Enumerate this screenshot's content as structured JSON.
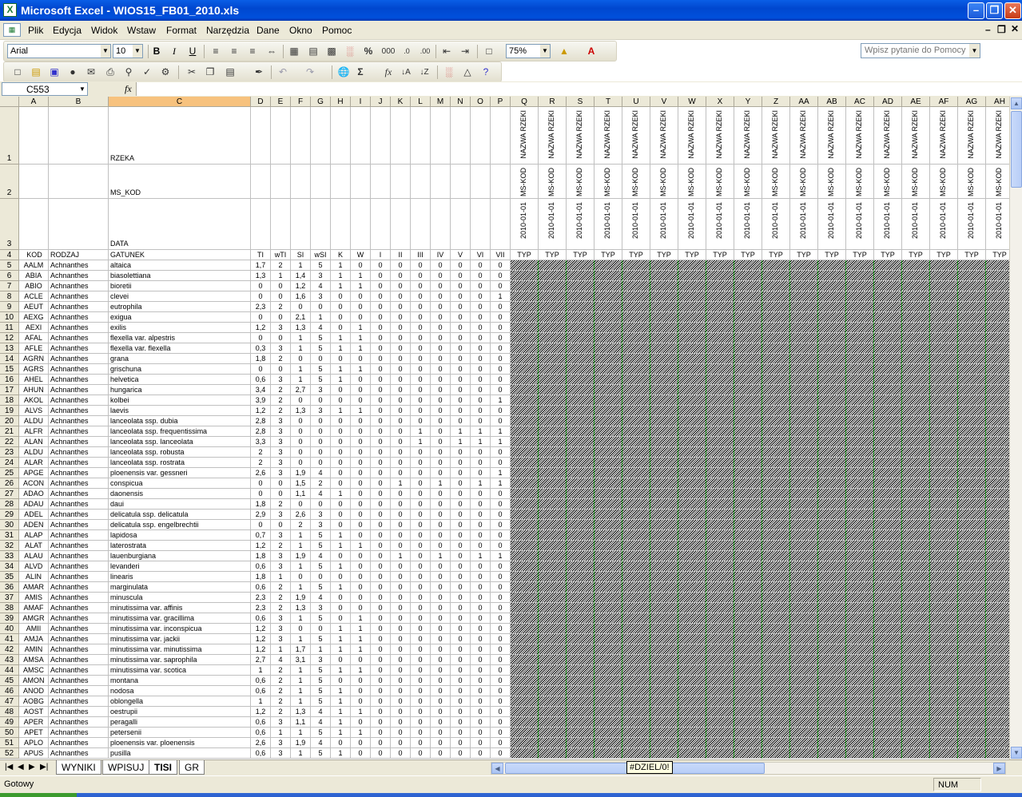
{
  "window": {
    "title": "Microsoft Excel - WIOS15_FB01_2010.xls",
    "app_icon": "excel-icon"
  },
  "menu": [
    "Plik",
    "Edycja",
    "Widok",
    "Wstaw",
    "Format",
    "Narzędzia",
    "Dane",
    "Okno",
    "Pomoc"
  ],
  "help_placeholder": "Wpisz pytanie do Pomocy",
  "formatting": {
    "font": "Arial",
    "size": "10",
    "zoom": "75%",
    "bold": "B",
    "italic": "I",
    "underline": "U",
    "percent": "%",
    "thousands": "000"
  },
  "namebox": "C553",
  "fx_label": "fx",
  "columns": [
    "A",
    "B",
    "C",
    "D",
    "E",
    "F",
    "G",
    "H",
    "I",
    "J",
    "K",
    "L",
    "M",
    "N",
    "O",
    "P",
    "Q",
    "R",
    "S",
    "T",
    "U",
    "V",
    "W",
    "X",
    "Y",
    "Z",
    "AA",
    "AB",
    "AC",
    "AD",
    "AE",
    "AF",
    "AG",
    "AH"
  ],
  "header_rows": {
    "row1_label": "RZEKA",
    "row2_label": "MS_KOD",
    "row3_label": "DATA",
    "q_row1": "NAZWA RZEKI",
    "q_row2": "MS-KOD",
    "q_row3": "2010-01-01",
    "typ": "TYP",
    "row4": [
      "KOD",
      "RODZAJ",
      "GATUNEK",
      "TI",
      "wTI",
      "SI",
      "wSI",
      "K",
      "W",
      "I",
      "II",
      "III",
      "IV",
      "V",
      "VI",
      "VII"
    ]
  },
  "error_placeholder": "#####",
  "rows": [
    [
      "AALM",
      "Achnanthes",
      "altaica",
      "1,7",
      "2",
      "1",
      "5",
      "1",
      "0",
      "0",
      "0",
      "0",
      "0",
      "0",
      "0",
      "0"
    ],
    [
      "ABIA",
      "Achnanthes",
      "biasolettiana",
      "1,3",
      "1",
      "1,4",
      "3",
      "1",
      "1",
      "0",
      "0",
      "0",
      "0",
      "0",
      "0",
      "0"
    ],
    [
      "ABIO",
      "Achnanthes",
      "bioretii",
      "0",
      "0",
      "1,2",
      "4",
      "1",
      "1",
      "0",
      "0",
      "0",
      "0",
      "0",
      "0",
      "0"
    ],
    [
      "ACLE",
      "Achnanthes",
      "clevei",
      "0",
      "0",
      "1,6",
      "3",
      "0",
      "0",
      "0",
      "0",
      "0",
      "0",
      "0",
      "0",
      "1"
    ],
    [
      "AEUT",
      "Achnanthes",
      "eutrophila",
      "2,3",
      "2",
      "0",
      "0",
      "0",
      "0",
      "0",
      "0",
      "0",
      "0",
      "0",
      "0",
      "0"
    ],
    [
      "AEXG",
      "Achnanthes",
      "exigua",
      "0",
      "0",
      "2,1",
      "1",
      "0",
      "0",
      "0",
      "0",
      "0",
      "0",
      "0",
      "0",
      "0"
    ],
    [
      "AEXI",
      "Achnanthes",
      "exilis",
      "1,2",
      "3",
      "1,3",
      "4",
      "0",
      "1",
      "0",
      "0",
      "0",
      "0",
      "0",
      "0",
      "0"
    ],
    [
      "AFAL",
      "Achnanthes",
      "flexella  var. alpestris",
      "0",
      "0",
      "1",
      "5",
      "1",
      "1",
      "0",
      "0",
      "0",
      "0",
      "0",
      "0",
      "0"
    ],
    [
      "AFLE",
      "Achnanthes",
      "flexella var. flexella",
      "0,3",
      "3",
      "1",
      "5",
      "1",
      "1",
      "0",
      "0",
      "0",
      "0",
      "0",
      "0",
      "0"
    ],
    [
      "AGRN",
      "Achnanthes",
      "grana",
      "1,8",
      "2",
      "0",
      "0",
      "0",
      "0",
      "0",
      "0",
      "0",
      "0",
      "0",
      "0",
      "0"
    ],
    [
      "AGRS",
      "Achnanthes",
      "grischuna",
      "0",
      "0",
      "1",
      "5",
      "1",
      "1",
      "0",
      "0",
      "0",
      "0",
      "0",
      "0",
      "0"
    ],
    [
      "AHEL",
      "Achnanthes",
      "helvetica",
      "0,6",
      "3",
      "1",
      "5",
      "1",
      "0",
      "0",
      "0",
      "0",
      "0",
      "0",
      "0",
      "0"
    ],
    [
      "AHUN",
      "Achnanthes",
      "hungarica",
      "3,4",
      "2",
      "2,7",
      "3",
      "0",
      "0",
      "0",
      "0",
      "0",
      "0",
      "0",
      "0",
      "0"
    ],
    [
      "AKOL",
      "Achnanthes",
      "kolbei",
      "3,9",
      "2",
      "0",
      "0",
      "0",
      "0",
      "0",
      "0",
      "0",
      "0",
      "0",
      "0",
      "1"
    ],
    [
      "ALVS",
      "Achnanthes",
      "laevis",
      "1,2",
      "2",
      "1,3",
      "3",
      "1",
      "1",
      "0",
      "0",
      "0",
      "0",
      "0",
      "0",
      "0"
    ],
    [
      "ALDU",
      "Achnanthes",
      "lanceolata ssp. dubia",
      "2,8",
      "3",
      "0",
      "0",
      "0",
      "0",
      "0",
      "0",
      "0",
      "0",
      "0",
      "0",
      "0"
    ],
    [
      "ALFR",
      "Achnanthes",
      "lanceolata ssp. frequentissima",
      "2,8",
      "3",
      "0",
      "0",
      "0",
      "0",
      "0",
      "0",
      "1",
      "0",
      "1",
      "1",
      "1"
    ],
    [
      "ALAN",
      "Achnanthes",
      "lanceolata ssp. lanceolata",
      "3,3",
      "3",
      "0",
      "0",
      "0",
      "0",
      "0",
      "0",
      "1",
      "0",
      "1",
      "1",
      "1"
    ],
    [
      "ALDU",
      "Achnanthes",
      "lanceolata ssp. robusta",
      "2",
      "3",
      "0",
      "0",
      "0",
      "0",
      "0",
      "0",
      "0",
      "0",
      "0",
      "0",
      "0"
    ],
    [
      "ALAR",
      "Achnanthes",
      "lanceolata ssp. rostrata",
      "2",
      "3",
      "0",
      "0",
      "0",
      "0",
      "0",
      "0",
      "0",
      "0",
      "0",
      "0",
      "0"
    ],
    [
      "APGE",
      "Achnanthes",
      "ploenensis var. gessneri",
      "2,6",
      "3",
      "1,9",
      "4",
      "0",
      "0",
      "0",
      "0",
      "0",
      "0",
      "0",
      "0",
      "1"
    ],
    [
      "ACON",
      "Achnanthes",
      "conspicua",
      "0",
      "0",
      "1,5",
      "2",
      "0",
      "0",
      "0",
      "1",
      "0",
      "1",
      "0",
      "1",
      "1"
    ],
    [
      "ADAO",
      "Achnanthes",
      "daonensis",
      "0",
      "0",
      "1,1",
      "4",
      "1",
      "0",
      "0",
      "0",
      "0",
      "0",
      "0",
      "0",
      "0"
    ],
    [
      "ADAU",
      "Achnanthes",
      "daui",
      "1,8",
      "2",
      "0",
      "0",
      "0",
      "0",
      "0",
      "0",
      "0",
      "0",
      "0",
      "0",
      "0"
    ],
    [
      "ADEL",
      "Achnanthes",
      "delicatula ssp. delicatula",
      "2,9",
      "3",
      "2,6",
      "3",
      "0",
      "0",
      "0",
      "0",
      "0",
      "0",
      "0",
      "0",
      "0"
    ],
    [
      "ADEN",
      "Achnanthes",
      "delicatula ssp. engelbrechtii",
      "0",
      "0",
      "2",
      "3",
      "0",
      "0",
      "0",
      "0",
      "0",
      "0",
      "0",
      "0",
      "0"
    ],
    [
      "ALAP",
      "Achnanthes",
      "lapidosa",
      "0,7",
      "3",
      "1",
      "5",
      "1",
      "0",
      "0",
      "0",
      "0",
      "0",
      "0",
      "0",
      "0"
    ],
    [
      "ALAT",
      "Achnanthes",
      "laterostrata",
      "1,2",
      "2",
      "1",
      "5",
      "1",
      "1",
      "0",
      "0",
      "0",
      "0",
      "0",
      "0",
      "0"
    ],
    [
      "ALAU",
      "Achnanthes",
      "lauenburgiana",
      "1,8",
      "3",
      "1,9",
      "4",
      "0",
      "0",
      "0",
      "1",
      "0",
      "1",
      "0",
      "1",
      "1"
    ],
    [
      "ALVD",
      "Achnanthes",
      "levanderi",
      "0,6",
      "3",
      "1",
      "5",
      "1",
      "0",
      "0",
      "0",
      "0",
      "0",
      "0",
      "0",
      "0"
    ],
    [
      "ALIN",
      "Achnanthes",
      "linearis",
      "1,8",
      "1",
      "0",
      "0",
      "0",
      "0",
      "0",
      "0",
      "0",
      "0",
      "0",
      "0",
      "0"
    ],
    [
      "AMAR",
      "Achnanthes",
      "marginulata",
      "0,6",
      "2",
      "1",
      "5",
      "1",
      "0",
      "0",
      "0",
      "0",
      "0",
      "0",
      "0",
      "0"
    ],
    [
      "AMIS",
      "Achnanthes",
      "minuscula",
      "2,3",
      "2",
      "1,9",
      "4",
      "0",
      "0",
      "0",
      "0",
      "0",
      "0",
      "0",
      "0",
      "0"
    ],
    [
      "AMAF",
      "Achnanthes",
      "minutissima var. affinis",
      "2,3",
      "2",
      "1,3",
      "3",
      "0",
      "0",
      "0",
      "0",
      "0",
      "0",
      "0",
      "0",
      "0"
    ],
    [
      "AMGR",
      "Achnanthes",
      "minutissima var. gracillima",
      "0,6",
      "3",
      "1",
      "5",
      "0",
      "1",
      "0",
      "0",
      "0",
      "0",
      "0",
      "0",
      "0"
    ],
    [
      "AMII",
      "Achnanthes",
      "minutissima var. inconspicua",
      "1,2",
      "3",
      "0",
      "0",
      "1",
      "1",
      "0",
      "0",
      "0",
      "0",
      "0",
      "0",
      "0"
    ],
    [
      "AMJA",
      "Achnanthes",
      "minutissima var. jackii",
      "1,2",
      "3",
      "1",
      "5",
      "1",
      "1",
      "0",
      "0",
      "0",
      "0",
      "0",
      "0",
      "0"
    ],
    [
      "AMIN",
      "Achnanthes",
      "minutissima var. minutissima",
      "1,2",
      "1",
      "1,7",
      "1",
      "1",
      "1",
      "0",
      "0",
      "0",
      "0",
      "0",
      "0",
      "0"
    ],
    [
      "AMSA",
      "Achnanthes",
      "minutissima var. saprophila",
      "2,7",
      "4",
      "3,1",
      "3",
      "0",
      "0",
      "0",
      "0",
      "0",
      "0",
      "0",
      "0",
      "0"
    ],
    [
      "AMSC",
      "Achnanthes",
      "minutissima var. scotica",
      "1",
      "2",
      "1",
      "5",
      "1",
      "1",
      "0",
      "0",
      "0",
      "0",
      "0",
      "0",
      "0"
    ],
    [
      "AMON",
      "Achnanthes",
      "montana",
      "0,6",
      "2",
      "1",
      "5",
      "0",
      "0",
      "0",
      "0",
      "0",
      "0",
      "0",
      "0",
      "0"
    ],
    [
      "ANOD",
      "Achnanthes",
      "nodosa",
      "0,6",
      "2",
      "1",
      "5",
      "1",
      "0",
      "0",
      "0",
      "0",
      "0",
      "0",
      "0",
      "0"
    ],
    [
      "AOBG",
      "Achnanthes",
      "oblongella",
      "1",
      "2",
      "1",
      "5",
      "1",
      "0",
      "0",
      "0",
      "0",
      "0",
      "0",
      "0",
      "0"
    ],
    [
      "AOST",
      "Achnanthes",
      "oestrupii",
      "1,2",
      "2",
      "1,3",
      "4",
      "1",
      "1",
      "0",
      "0",
      "0",
      "0",
      "0",
      "0",
      "0"
    ],
    [
      "APER",
      "Achnanthes",
      "peragalli",
      "0,6",
      "3",
      "1,1",
      "4",
      "1",
      "0",
      "0",
      "0",
      "0",
      "0",
      "0",
      "0",
      "0"
    ],
    [
      "APET",
      "Achnanthes",
      "petersenii",
      "0,6",
      "1",
      "1",
      "5",
      "1",
      "1",
      "0",
      "0",
      "0",
      "0",
      "0",
      "0",
      "0"
    ],
    [
      "APLO",
      "Achnanthes",
      "ploenensis var. ploenensis",
      "2,6",
      "3",
      "1,9",
      "4",
      "0",
      "0",
      "0",
      "0",
      "0",
      "0",
      "0",
      "0",
      "0"
    ],
    [
      "APUS",
      "Achnanthes",
      "pusilla",
      "0,6",
      "3",
      "1",
      "5",
      "1",
      "0",
      "0",
      "0",
      "0",
      "0",
      "0",
      "0",
      "0"
    ]
  ],
  "sheets": [
    "WYNIKI",
    "WPISUJ",
    "TISI",
    "GR"
  ],
  "active_sheet": "TISI",
  "error_tooltip": "#DZIEL/0!",
  "status": {
    "left": "Gotowy",
    "num": "NUM"
  },
  "icons": [
    "new-icon",
    "open-icon",
    "save-icon",
    "permission-icon",
    "email-icon",
    "print-icon",
    "print-preview-icon",
    "spelling-icon",
    "research-icon",
    "cut-icon",
    "copy-icon",
    "paste-icon",
    "format-painter-icon",
    "undo-icon",
    "redo-icon",
    "hyperlink-icon",
    "autosum-icon",
    "function-icon",
    "sort-asc-icon",
    "sort-desc-icon",
    "chart-icon",
    "drawing-icon",
    "help-icon"
  ]
}
